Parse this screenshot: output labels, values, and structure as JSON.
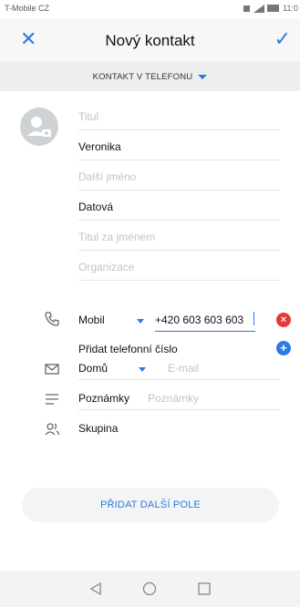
{
  "status": {
    "carrier": "T-Mobile CZ",
    "time": "11:0"
  },
  "header": {
    "title": "Nový kontakt"
  },
  "account": {
    "label": "KONTAKT V TELEFONU"
  },
  "form": {
    "title_placeholder": "Titul",
    "first_name": "Veronika",
    "middle_placeholder": "Další jméno",
    "last_name": "Datová",
    "suffix_placeholder": "Titul za jménem",
    "org_placeholder": "Organizace",
    "phone_type": "Mobil",
    "phone_value": "+420 603 603 603",
    "add_phone": "Přidat telefonní číslo",
    "email_type": "Domů",
    "email_placeholder": "E-mail",
    "notes_label": "Poznámky",
    "notes_placeholder": "Poznámky",
    "group_label": "Skupina"
  },
  "actions": {
    "add_field": "PŘIDAT DALŠÍ POLE"
  },
  "colors": {
    "accent": "#2c7ae6",
    "danger": "#e53935"
  }
}
